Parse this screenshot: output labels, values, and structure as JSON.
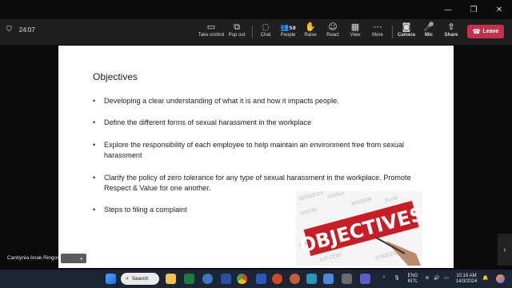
{
  "window": {
    "minimize": "—",
    "maximize": "❐",
    "close": "✕"
  },
  "meeting": {
    "timer": "24:07",
    "toolbar": [
      {
        "label": "Take control",
        "icon": "take-control-icon",
        "glyph": "▭"
      },
      {
        "label": "Pop out",
        "icon": "pop-out-icon",
        "glyph": "⧉"
      },
      {
        "label": "Chat",
        "icon": "chat-icon",
        "glyph": "◌"
      },
      {
        "label": "People",
        "icon": "people-icon",
        "glyph": "👥",
        "count": "58"
      },
      {
        "label": "Raise",
        "icon": "raise-hand-icon",
        "glyph": "✋"
      },
      {
        "label": "React",
        "icon": "react-icon",
        "glyph": "☺"
      },
      {
        "label": "View",
        "icon": "view-icon",
        "glyph": "▦"
      },
      {
        "label": "More",
        "icon": "more-icon",
        "glyph": "⋯"
      },
      {
        "label": "Camera",
        "icon": "camera-icon",
        "glyph": "◙"
      },
      {
        "label": "Mic",
        "icon": "mic-icon",
        "glyph": "🎤"
      },
      {
        "label": "Share",
        "icon": "share-icon",
        "glyph": "⇧"
      }
    ],
    "leave": "Leave"
  },
  "slide": {
    "title": "Objectives",
    "bullets": [
      "Developing a clear understanding of what it is and how it impacts people.",
      "Define the different forms of sexual harassment in the workplace",
      "Explore the responsibility of each employee to help maintain an environment free from sexual harassment",
      "Clarify the policy of zero tolerance for any type of sexual harassment in the workplace. Promote Respect & Value for one another.",
      "Steps to filing a complaint"
    ],
    "image_word": "OBJECTIVES"
  },
  "participant": "Cantiynia Anak Ringos",
  "taskbar": {
    "search": "Search",
    "lang": [
      "ENG",
      "INTL"
    ],
    "time": "10:16 AM",
    "date": "14/3/2024"
  },
  "colors": {
    "accent": "#c4314b",
    "meeting_bar": "#1f1f1f",
    "taskbar": "#1c2533"
  }
}
